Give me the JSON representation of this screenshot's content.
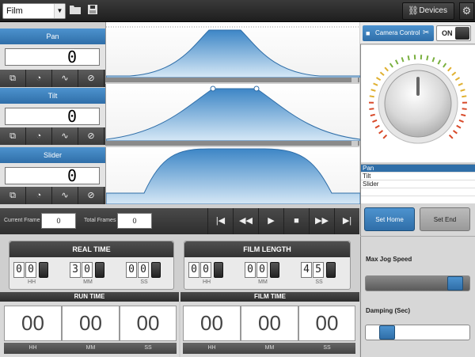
{
  "toolbar": {
    "mode_value": "Film",
    "devices_label": "Devices",
    "icons": [
      "folder-icon",
      "save-icon",
      "devices-icon",
      "gear-icon"
    ]
  },
  "axes": [
    {
      "label": "Pan",
      "value": "0"
    },
    {
      "label": "Tilt",
      "value": "0"
    },
    {
      "label": "Slider",
      "value": "0"
    }
  ],
  "axis_button_icons": [
    "keyframe-icon",
    "speed-icon",
    "curve-icon",
    "no-easing-icon"
  ],
  "transport": {
    "current_frame_label": "Current Frame",
    "current_frame_value": "0",
    "total_frames_label": "Total Frames",
    "total_frames_value": "0",
    "buttons": [
      "|◀",
      "◀◀",
      "▶",
      "■",
      "▶▶",
      "▶|"
    ]
  },
  "real_time": {
    "title": "REAL TIME",
    "hh": [
      "0",
      "0"
    ],
    "mm": [
      "3",
      "0"
    ],
    "ss": [
      "0",
      "0"
    ]
  },
  "film_length": {
    "title": "FILM LENGTH",
    "hh": [
      "0",
      "0"
    ],
    "mm": [
      "0",
      "0"
    ],
    "ss": [
      "4",
      "5"
    ]
  },
  "units": {
    "hh": "HH",
    "mm": "MM",
    "ss": "SS"
  },
  "run_time": {
    "title": "RUN TIME",
    "hh": "00",
    "mm": "00",
    "ss": "00"
  },
  "film_time": {
    "title": "FILM TIME",
    "hh": "00",
    "mm": "00",
    "ss": "00"
  },
  "camera": {
    "control_label": "Camera Control",
    "toggle_label": "ON"
  },
  "axis_list": {
    "items": [
      "Pan",
      "Tilt",
      "Slider"
    ],
    "selected": 0
  },
  "set_home_label": "Set Home",
  "set_end_label": "Set End",
  "max_jog_speed": {
    "label": "Max Jog Speed",
    "level": 0.93
  },
  "damping": {
    "label": "Damping (Sec)",
    "level": 0.15
  },
  "colors": {
    "accent": "#2f6ea8",
    "curve_fill": "#5a9fd6",
    "dark_bar": "#333333"
  }
}
